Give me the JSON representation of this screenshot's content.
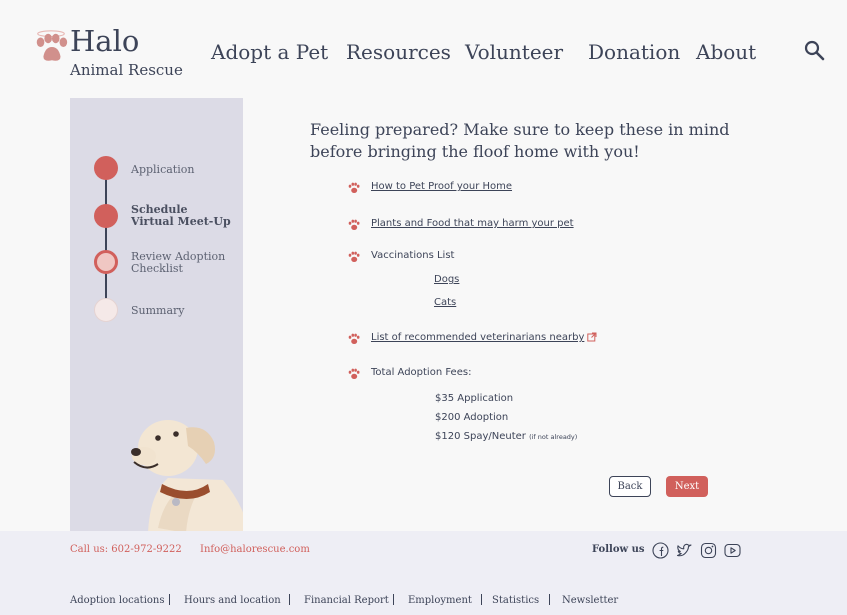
{
  "brand": {
    "name": "Halo",
    "subtitle": "Animal Rescue",
    "accent": "#d1605c",
    "text": "#3d4458",
    "sidebar_bg": "#dcdbe6"
  },
  "nav": {
    "items": [
      "Adopt a Pet",
      "Resources",
      "Volunteer",
      "Donation",
      "About"
    ],
    "search_icon": "search-icon"
  },
  "steps": [
    {
      "label": "Application",
      "status": "done"
    },
    {
      "label": "Schedule Virtual Meet-Up",
      "status": "done"
    },
    {
      "label": "Review Adoption Checklist",
      "status": "current"
    },
    {
      "label": "Summary",
      "status": "upcoming"
    }
  ],
  "main": {
    "heading": "Feeling prepared? Make sure to keep these in mind before bringing the floof home with you!",
    "items": {
      "pet_proof": "How to Pet Proof your Home",
      "plants_food": "Plants and Food that may harm your pet",
      "vaccinations": "Vaccinations List",
      "dogs": "Dogs",
      "cats": "Cats",
      "vets": "List of recommended veterinarians nearby",
      "fees_title": "Total Adoption Fees:",
      "fee_application": "$35 Application",
      "fee_adoption": "$200 Adoption",
      "fee_spay": "$120 Spay/Neuter",
      "fee_spay_note": "(if not already)"
    },
    "buttons": {
      "back": "Back",
      "next": "Next"
    }
  },
  "footer": {
    "call": "Call us: 602-972-9222",
    "email": "Info@halorescue.com",
    "follow": "Follow us",
    "social": [
      "facebook-icon",
      "twitter-icon",
      "instagram-icon",
      "youtube-icon"
    ],
    "links": [
      "Adoption locations",
      "Hours and location",
      "Financial Report",
      "Employment",
      "Statistics",
      "Newsletter"
    ]
  }
}
